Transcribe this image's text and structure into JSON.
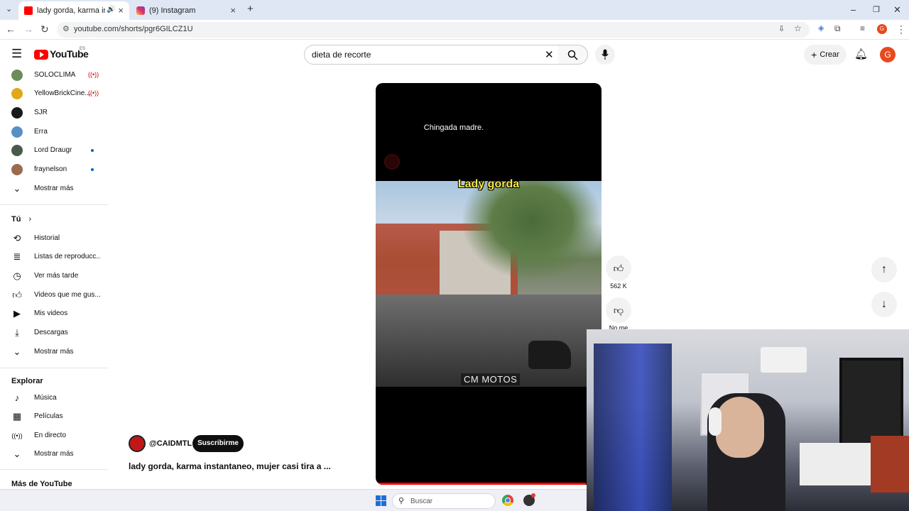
{
  "browser": {
    "tabs": [
      {
        "title": "lady gorda, karma instantaneo",
        "active": true
      },
      {
        "title": "(9) Instagram",
        "active": false
      }
    ],
    "url": "youtube.com/shorts/pgr6GILCZ1U"
  },
  "header": {
    "logo_text": "YouTube",
    "logo_region": "ES",
    "search_value": "dieta de recorte",
    "create_label": "Crear",
    "avatar_letter": "G"
  },
  "sidebar": {
    "subscriptions": [
      {
        "label": "SOLOCLIMA",
        "status": "live"
      },
      {
        "label": "YellowBrickCine...",
        "status": "live"
      },
      {
        "label": "SJR",
        "status": ""
      },
      {
        "label": "Erra",
        "status": ""
      },
      {
        "label": "Lord Draugr",
        "status": "new"
      },
      {
        "label": "fraynelson",
        "status": "new"
      }
    ],
    "show_more_1": "Mostrar más",
    "you_heading": "Tú",
    "you_items": [
      {
        "label": "Historial",
        "icon": "history-icon"
      },
      {
        "label": "Listas de reproducc...",
        "icon": "playlist-icon"
      },
      {
        "label": "Ver más tarde",
        "icon": "clock-icon"
      },
      {
        "label": "Videos que me gus...",
        "icon": "thumb-up-icon"
      },
      {
        "label": "Mis videos",
        "icon": "video-icon"
      },
      {
        "label": "Descargas",
        "icon": "download-icon"
      }
    ],
    "show_more_2": "Mostrar más",
    "explore_heading": "Explorar",
    "explore_items": [
      {
        "label": "Música",
        "icon": "music-icon"
      },
      {
        "label": "Películas",
        "icon": "film-icon"
      },
      {
        "label": "En directo",
        "icon": "live-icon"
      }
    ],
    "show_more_3": "Mostrar más",
    "more_heading": "Más de YouTube"
  },
  "video": {
    "caption_top": "Chingada madre.",
    "overlay_title": "Lady gorda",
    "watermark": "CM MOTOS",
    "progress_fraction": 0.93
  },
  "actions": {
    "like_count": "562 K",
    "dislike_label": "No me"
  },
  "channel": {
    "handle": "@CAIDMTL",
    "subscribe_label": "Suscribirme",
    "video_title": "lady gorda, karma instantaneo, mujer casi tira a ..."
  },
  "taskbar": {
    "search_placeholder": "Buscar"
  },
  "colors": {
    "brand_red": "#ff0000",
    "caption_yellow": "#f5e84a",
    "link_blue": "#065fd4"
  }
}
